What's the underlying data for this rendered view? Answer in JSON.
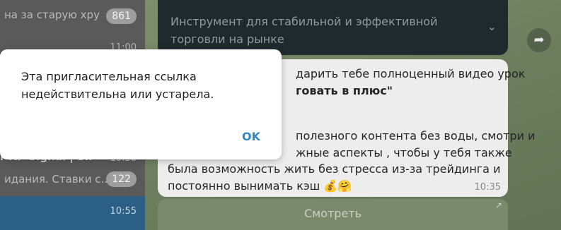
{
  "chat_list": {
    "row1": {
      "preview": "на за старую хру",
      "badge": "861",
      "time": "11:00"
    },
    "row2": {
      "title": "r XP Signal | Sil",
      "time": "10:58",
      "preview": "идания.  Ставки с...",
      "badge": "122"
    },
    "row3": {
      "time": "10:55"
    }
  },
  "channel_post": {
    "header_text": "Инструмент для стабильной и эффективной торговли на рынке",
    "message_lines": [
      "дарить тебе полноценный видео урок",
      "говать в плюс\"",
      "полезного контента без воды, смотри и",
      "жные аспекты , чтобы у тебя также",
      "была возможность жить без стресса из-за трейдинга и",
      "постоянно вынимать кэш 💰🤗"
    ],
    "time": "10:35",
    "watch_button": "Смотреть"
  },
  "dialog": {
    "message": "Эта пригласительная ссылка недействительна или устарела.",
    "ok_label": "OK"
  }
}
